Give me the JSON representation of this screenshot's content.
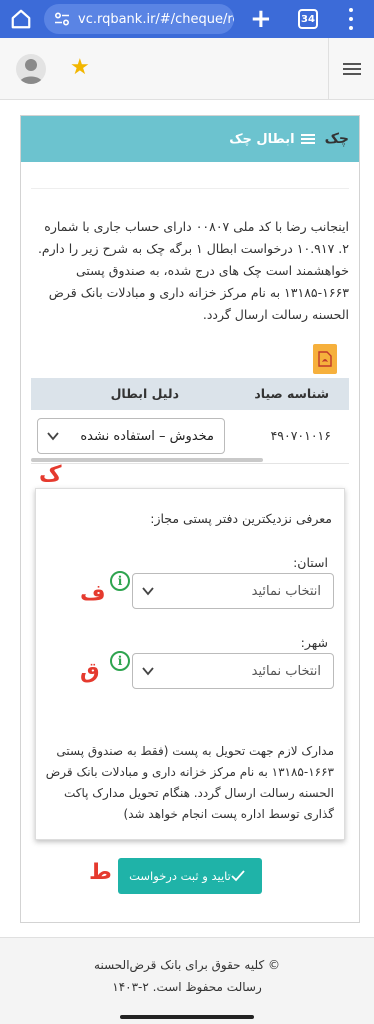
{
  "browser": {
    "url": "vc.rqbank.ir/#/cheque/re",
    "tab_count": "34"
  },
  "colors": {
    "browser_bar": "#3c6bd8",
    "card_header": "#6cc3cf",
    "submit_button": "#1fb3a8",
    "pdf_button": "#f6b03c",
    "annotation_marks": "#e53a2e",
    "info_icon": "#2ea44f"
  },
  "card": {
    "title": "چک",
    "subtitle": "ابطال چک",
    "intro_text": "اینجانب رضا         با کد ملی          ۰۰۸۰۷ دارای حساب جاری با شماره ۲.          ۱۰.۹۱۷ درخواست ابطال ۱ برگه چک به شرح زیر را دارم. خواهشمند است چک های درج شده، به صندوق پستی ۱۶۶۳-۱۳۱۸۵ به نام مرکز خزانه داری و مبادلات بانک قرض الحسنه رسالت ارسال گردد."
  },
  "table": {
    "col_sayad_id": "شناسه صیاد",
    "col_reason": "دلیل ابطال",
    "row_sayad_id": "۴۹۰۷۰۱۰۱۶",
    "row_reason_selected": "مخدوش – استفاده نشده"
  },
  "postal": {
    "title": "معرفی نزدیکترین دفتر پستی مجاز:",
    "state_label": "استان:",
    "state_placeholder": "انتخاب نمائید",
    "city_label": "شهر:",
    "city_placeholder": "انتخاب نمائید",
    "note": "مدارک لازم جهت تحویل به پست (فقط به صندوق پستی ۱۶۶۳-۱۳۱۸۵ به نام مرکز خزانه داری و مبادلات بانک قرض الحسنه رسالت ارسال گردد. هنگام تحویل مدارک پاکت گذاری توسط اداره پست انجام خواهد شد)"
  },
  "submit_label": "تایید و ثبت درخواست",
  "annotations": {
    "k": "ک",
    "f": "ف",
    "q": "ق",
    "t": "ط"
  },
  "footer": {
    "line1": "© کلیه حقوق برای بانک قرض‌الحسنه",
    "line2": "رسالت محفوظ است. ۲-۱۴۰۳"
  }
}
